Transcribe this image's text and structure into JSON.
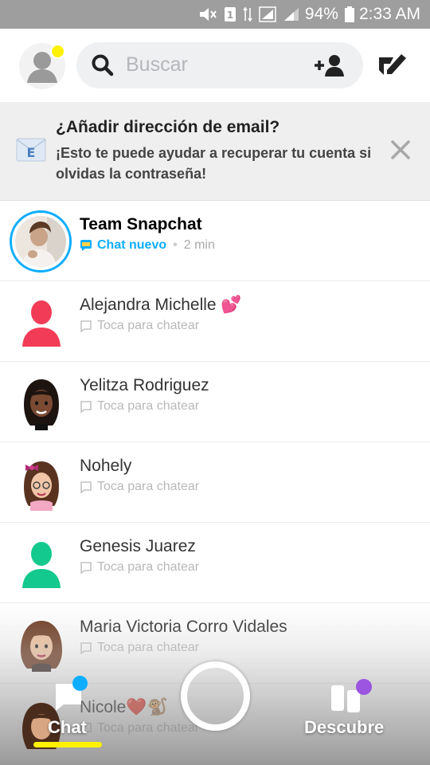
{
  "status_bar": {
    "battery": "94%",
    "time": "2:33 AM"
  },
  "header": {
    "search_placeholder": "Buscar"
  },
  "banner": {
    "title": "¿Añadir dirección de email?",
    "body": "¡Esto te puede ayudar a recuperar tu cuenta si olvidas la contraseña!"
  },
  "chats": [
    {
      "name": "Team Snapchat",
      "status": "Chat nuevo",
      "time": "2 min",
      "avatar": "story-photo"
    },
    {
      "name": "Alejandra Michelle 💕",
      "status": "Toca para chatear",
      "avatar": "silhouette-red"
    },
    {
      "name": "Yelitza Rodriguez",
      "status": "Toca para chatear",
      "avatar": "bitmoji-dark-hair"
    },
    {
      "name": "Nohely",
      "status": "Toca para chatear",
      "avatar": "bitmoji-bow-glasses"
    },
    {
      "name": "Genesis Juarez",
      "status": "Toca para chatear",
      "avatar": "silhouette-green"
    },
    {
      "name": "Maria Victoria Corro Vidales",
      "status": "Toca para chatear",
      "avatar": "bitmoji-brown-hair"
    },
    {
      "name": "Nicole❤️🐒",
      "status": "Toca para chatear",
      "avatar": "bitmoji-brown-hair"
    }
  ],
  "bottom_nav": {
    "chat_label": "Chat",
    "discover_label": "Descubre"
  },
  "colors": {
    "snap_blue": "#0eadff",
    "snap_yellow": "#fff200",
    "discover_purple": "#9b55e0",
    "silhouette_red": "#f23c57",
    "silhouette_green": "#13c98d"
  }
}
